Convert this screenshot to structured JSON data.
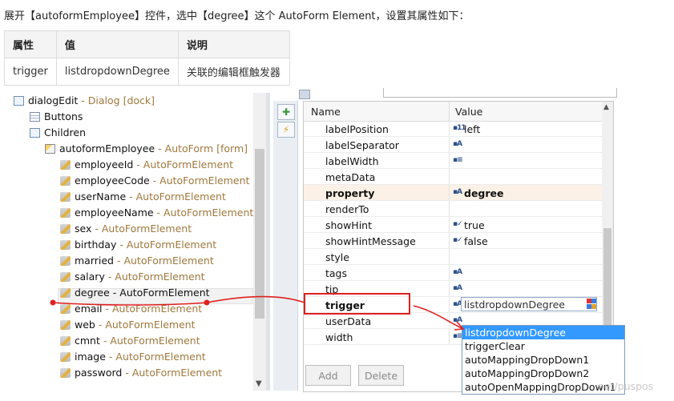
{
  "intro": "展开【autoformEmployee】控件，选中【degree】这个 AutoForm Element，设置其属性如下：",
  "info_table": {
    "headers": [
      "属性",
      "值",
      "说明"
    ],
    "rows": [
      [
        "trigger",
        "listdropdownDegree",
        "关联的编辑框触发器"
      ]
    ]
  },
  "tree": {
    "items": [
      {
        "label": "dialogEdit",
        "type": " - Dialog [dock]",
        "icon": "dialog-icon"
      },
      {
        "label": "Buttons",
        "type": "",
        "icon": "buttons-icon"
      },
      {
        "label": "Children",
        "type": "",
        "icon": "children-icon"
      },
      {
        "label": "autoformEmployee",
        "type": " - AutoForm [form]",
        "icon": "autoform-icon"
      },
      {
        "label": "employeeId",
        "type": " - AutoFormElement",
        "icon": "element-icon"
      },
      {
        "label": "employeeCode",
        "type": " - AutoFormElement",
        "icon": "element-icon"
      },
      {
        "label": "userName",
        "type": " - AutoFormElement",
        "icon": "element-icon"
      },
      {
        "label": "employeeName",
        "type": " - AutoFormElement",
        "icon": "element-icon"
      },
      {
        "label": "sex",
        "type": " - AutoFormElement",
        "icon": "element-icon"
      },
      {
        "label": "birthday",
        "type": " - AutoFormElement",
        "icon": "element-icon"
      },
      {
        "label": "married",
        "type": " - AutoFormElement",
        "icon": "element-icon"
      },
      {
        "label": "salary",
        "type": " - AutoFormElement",
        "icon": "element-icon"
      },
      {
        "label": "degree",
        "type": " - AutoFormElement",
        "icon": "element-icon"
      },
      {
        "label": "email",
        "type": " - AutoFormElement",
        "icon": "element-icon"
      },
      {
        "label": "web",
        "type": " - AutoFormElement",
        "icon": "element-icon"
      },
      {
        "label": "cmnt",
        "type": " - AutoFormElement",
        "icon": "element-icon"
      },
      {
        "label": "image",
        "type": " - AutoFormElement",
        "icon": "element-icon"
      },
      {
        "label": "password",
        "type": " - AutoFormElement",
        "icon": "element-icon"
      }
    ]
  },
  "grid": {
    "col_name": "Name",
    "col_value": "Value",
    "rows": [
      {
        "name": "labelPosition",
        "icon": "▪11",
        "value": "left"
      },
      {
        "name": "labelSeparator",
        "icon": "▪A",
        "value": ""
      },
      {
        "name": "labelWidth",
        "icon": "▪≡",
        "value": ""
      },
      {
        "name": "metaData",
        "icon": "",
        "value": ""
      },
      {
        "name": "property",
        "icon": "▪A",
        "value": "degree"
      },
      {
        "name": "renderTo",
        "icon": "",
        "value": ""
      },
      {
        "name": "showHint",
        "icon": "▪✓",
        "value": "true"
      },
      {
        "name": "showHintMessage",
        "icon": "▪✓",
        "value": "false"
      },
      {
        "name": "style",
        "icon": "",
        "value": ""
      },
      {
        "name": "tags",
        "icon": "▪A",
        "value": ""
      },
      {
        "name": "tip",
        "icon": "▪A",
        "value": ""
      },
      {
        "name": "trigger",
        "icon": "▪A",
        "value": "listdropdownDegree"
      },
      {
        "name": "userData",
        "icon": "▪A",
        "value": ""
      },
      {
        "name": "width",
        "icon": "▪≡",
        "value": ""
      }
    ],
    "add_label": "Add",
    "delete_label": "Delete"
  },
  "dropdown": {
    "options": [
      "listdropdownDegree",
      "triggerClear",
      "autoMappingDropDown1",
      "autoMappingDropDown2",
      "autoOpenMappingDropDown1"
    ]
  },
  "watermark": "net/puspos"
}
